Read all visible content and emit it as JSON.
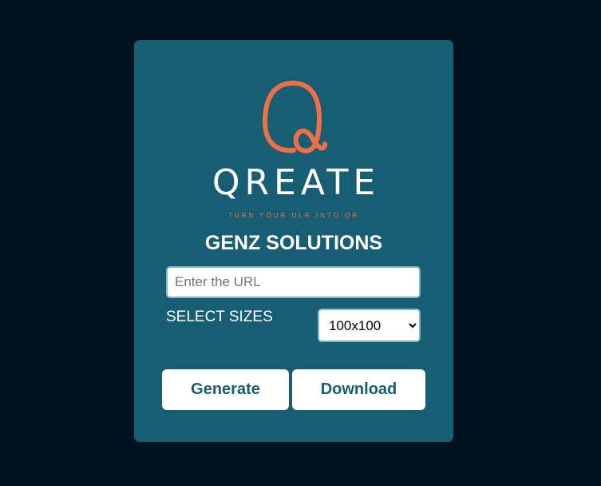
{
  "colors": {
    "page_background": "#001220",
    "card_background": "#175e75",
    "accent": "#f26f45",
    "text": "#ffffff",
    "button_text": "#175e75"
  },
  "logo": {
    "icon": "q-loop-icon",
    "brand": "QREATE",
    "tagline": "TURN YOUR ULR INTO QR"
  },
  "company": "GENZ SOLUTIONS",
  "url_input": {
    "value": "",
    "placeholder": "Enter the URL"
  },
  "size_label": "SELECT SIZES",
  "size_select": {
    "selected": "100x100"
  },
  "buttons": {
    "generate": "Generate",
    "download": "Download"
  }
}
